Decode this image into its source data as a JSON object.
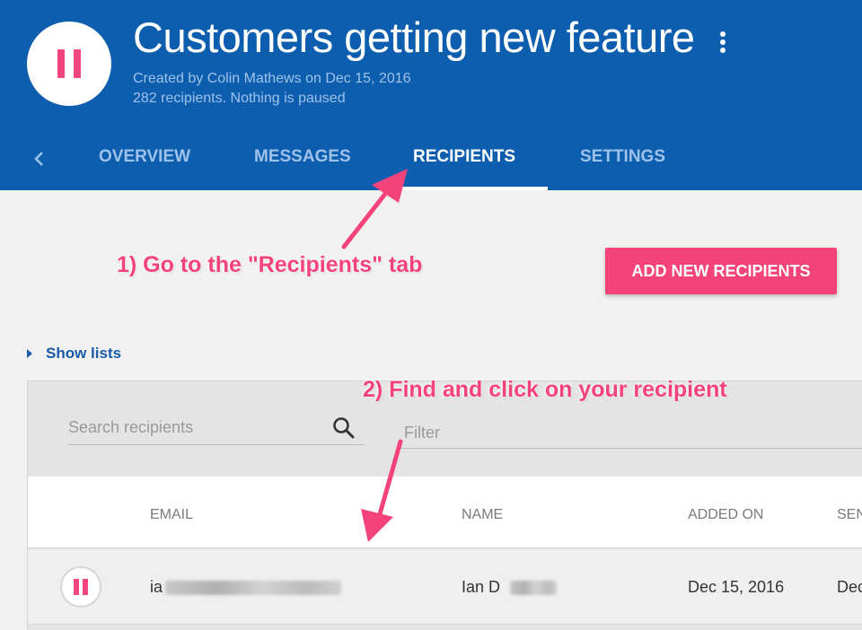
{
  "header": {
    "title": "Customers getting new feature",
    "created_line": "Created by Colin Mathews on Dec 15, 2016",
    "status_line": "282 recipients. Nothing is paused",
    "status_icon": "pause-icon",
    "more_icon": "more-vert-icon"
  },
  "tabs": [
    {
      "label": "OVERVIEW",
      "active": false
    },
    {
      "label": "MESSAGES",
      "active": false
    },
    {
      "label": "RECIPIENTS",
      "active": true
    },
    {
      "label": "SETTINGS",
      "active": false
    }
  ],
  "actions": {
    "add_recipients_label": "ADD NEW RECIPIENTS"
  },
  "lists": {
    "show_lists_label": "Show lists"
  },
  "search": {
    "placeholder": "Search recipients",
    "value": ""
  },
  "filter": {
    "placeholder": "Filter",
    "value": ""
  },
  "table": {
    "columns": [
      "EMAIL",
      "NAME",
      "ADDED ON",
      "SEN"
    ],
    "rows": [
      {
        "email": "ia",
        "name": "Ian D",
        "added_on": "Dec 15, 2016",
        "sent": "Dec"
      }
    ]
  },
  "annotations": {
    "step1": "1) Go to the \"Recipients\" tab",
    "step2": "2) Find and click on your recipient"
  },
  "colors": {
    "header_bg": "#0d5eaf",
    "accent_pink": "#f4427b",
    "link_blue": "#1a5ba8"
  }
}
